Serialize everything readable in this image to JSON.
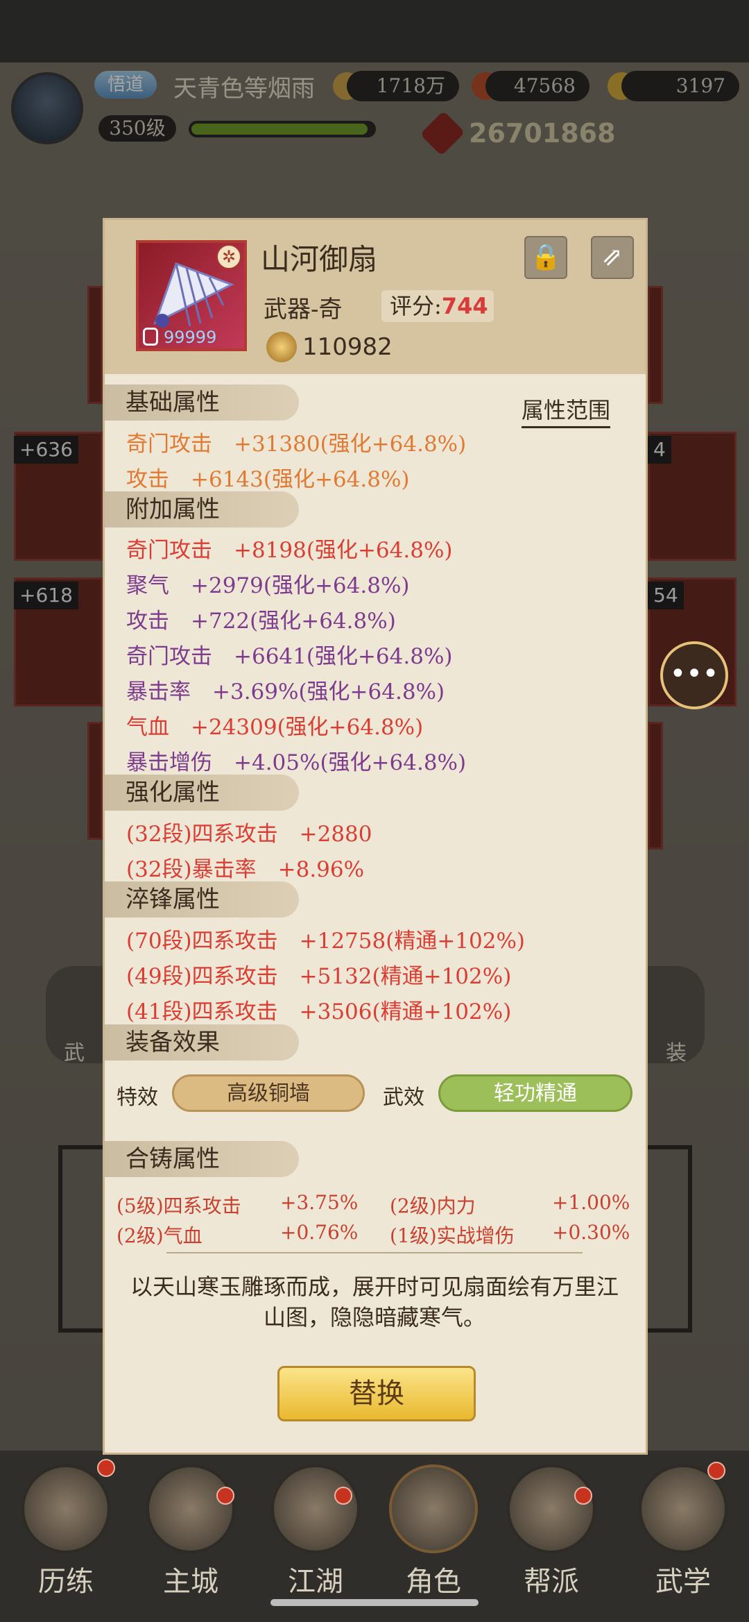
{
  "header": {
    "title_badge": "悟道",
    "player_name": "天青色等烟雨",
    "silver": "1718万",
    "resource2": "47568",
    "gold": "3197",
    "level": "350级",
    "exp_fraction": 0.97,
    "power": "26701868"
  },
  "side_cards": {
    "left_1": "+636",
    "left_2": "+618",
    "right_1": "4",
    "right_2": "54",
    "lvl": "99999"
  },
  "item": {
    "name": "山河御扇",
    "type": "武器-奇",
    "score_label": "评分:",
    "score_value": "744",
    "level": "99999",
    "price": "110982",
    "attr_range": "属性范围"
  },
  "sections": {
    "base": "基础属性",
    "extra": "附加属性",
    "enhance": "强化属性",
    "temper": "淬锋属性",
    "effect": "装备效果",
    "forge": "合铸属性"
  },
  "base_attrs": [
    "奇门攻击　+31380(强化+64.8%)",
    "攻击　+6143(强化+64.8%)"
  ],
  "extra_attrs": [
    {
      "text": "奇门攻击　+8198(强化+64.8%)",
      "color": "red"
    },
    {
      "text": "聚气　+2979(强化+64.8%)",
      "color": "purple"
    },
    {
      "text": "攻击　+722(强化+64.8%)",
      "color": "purple"
    },
    {
      "text": "奇门攻击　+6641(强化+64.8%)",
      "color": "purple"
    },
    {
      "text": "暴击率　+3.69%(强化+64.8%)",
      "color": "purple"
    },
    {
      "text": "气血　+24309(强化+64.8%)",
      "color": "red"
    },
    {
      "text": "暴击增伤　+4.05%(强化+64.8%)",
      "color": "purple"
    }
  ],
  "enhance_attrs": [
    "(32段)四系攻击　+2880",
    "(32段)暴击率　+8.96%"
  ],
  "temper_attrs": [
    "(70段)四系攻击　+12758(精通+102%)",
    "(49段)四系攻击　+5132(精通+102%)",
    "(41段)四系攻击　+3506(精通+102%)"
  ],
  "effects": {
    "special_label": "特效",
    "special_value": "高级铜墙",
    "martial_label": "武效",
    "martial_value": "轻功精通"
  },
  "forge_attrs": [
    {
      "name": "(5级)四系攻击",
      "value": "+3.75%"
    },
    {
      "name": "(2级)内力",
      "value": "+1.00%"
    },
    {
      "name": "(2级)气血",
      "value": "+0.76%"
    },
    {
      "name": "(1级)实战增伤",
      "value": "+0.30%"
    }
  ],
  "description": "以天山寒玉雕琢而成，展开时可见扇面绘有万里江山图，隐隐暗藏寒气。",
  "replace_button": "替换",
  "nav": [
    "历练",
    "主城",
    "江湖",
    "角色",
    "帮派",
    "武学"
  ],
  "bg_labels": {
    "left": "武",
    "right": "装"
  }
}
